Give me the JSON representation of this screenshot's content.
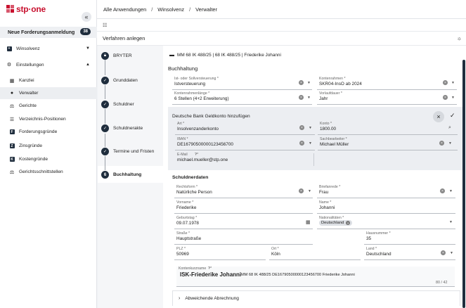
{
  "logo": {
    "text": "stp·one"
  },
  "sidebar": {
    "collapse": "«",
    "new_claim": {
      "label": "Neue Forderungsanmeldung",
      "count": "38"
    },
    "groups": [
      {
        "label": "Winsolvenz"
      },
      {
        "label": "Einstellungen"
      }
    ],
    "items": [
      {
        "label": "Kanzlei"
      },
      {
        "label": "Verwalter"
      },
      {
        "label": "Gerichte"
      },
      {
        "label": "Verzeichnis-Positionen"
      },
      {
        "label": "Forderungsgründe"
      },
      {
        "label": "Zinsgründe"
      },
      {
        "label": "Kostengründe"
      },
      {
        "label": "Gerichtsschnittstellen"
      }
    ]
  },
  "breadcrumb": {
    "a": "Alle Anwendungen",
    "b": "Winsolvenz",
    "c": "Verwalter",
    "sep": "/"
  },
  "page_title": "Verfahren anlegen",
  "stepper": [
    {
      "label": "BRYTER",
      "icon": "lock"
    },
    {
      "label": "Grunddaten",
      "icon": "check"
    },
    {
      "label": "Schuldner",
      "icon": "check"
    },
    {
      "label": "Schuldnerakte",
      "icon": "check"
    },
    {
      "label": "Termine und Fristen",
      "icon": "check"
    },
    {
      "label": "Buchhaltung",
      "num": "6"
    }
  ],
  "case_head": "MM 68 IK 488/25  |  68 IK 488/25  |  Friederike Johanni",
  "section_title": "Buchhaltung",
  "fields": {
    "ist_soll": {
      "label": "Ist- oder Sollversteuerung *",
      "value": "Istversteuerung"
    },
    "kontenrahmen": {
      "label": "Kontenrahmen *",
      "value": "SKR04-InsO ab 2024"
    },
    "kontenlaenge": {
      "label": "Kontenrahmenlänge *",
      "value": "6 Stellen (4+2 Erweiterung)"
    },
    "vorlauf": {
      "label": "Vorlaufdauer *",
      "value": "Jahr"
    }
  },
  "bank": {
    "title": "Deutsche Bank Geldkonto hinzufügen",
    "art": {
      "label": "Art *",
      "value": "Insolvenzanderkonto"
    },
    "konto": {
      "label": "Konto *",
      "value": "1800.00"
    },
    "iban": {
      "label": "IBAN *",
      "value": "DE16790500000123456700"
    },
    "sach": {
      "label": "Sachbearbeiter *",
      "value": "Michael Müller"
    },
    "email": {
      "label": "E-Mail",
      "value": "michael.mueller@stp.one"
    }
  },
  "schuldner": {
    "title": "Schuldnerdaten",
    "rechtsform": {
      "label": "Rechtsform *",
      "value": "Natürliche Person"
    },
    "anrede": {
      "label": "Briefanrede *",
      "value": "Frau"
    },
    "vorname": {
      "label": "Vorname *",
      "value": "Friederike"
    },
    "name": {
      "label": "Name *",
      "value": "Johanni"
    },
    "geburtstag": {
      "label": "Geburtstag *",
      "value": "09.07.1978"
    },
    "nationalitaet": {
      "label": "Nationalitäten *",
      "value": "Deutschland"
    },
    "strasse": {
      "label": "Straße *",
      "value": "Hauptstraße"
    },
    "hausnummer": {
      "label": "Hausnummer *",
      "value": "35"
    },
    "plz": {
      "label": "PLZ *",
      "value": "50969"
    },
    "ort": {
      "label": "Ort *",
      "value": "Köln"
    },
    "land": {
      "label": "Land *",
      "value": "Deutschland"
    }
  },
  "konto_ref": {
    "label": "Kontenkurzname",
    "name": "ISK-Friederike Johanni",
    "rest": "MM 68 IK 488/25 DE16790500000123456700 Friederike Johanni",
    "counter": "80 / 42"
  },
  "alt_billing": "Abweichende Abrechnung"
}
